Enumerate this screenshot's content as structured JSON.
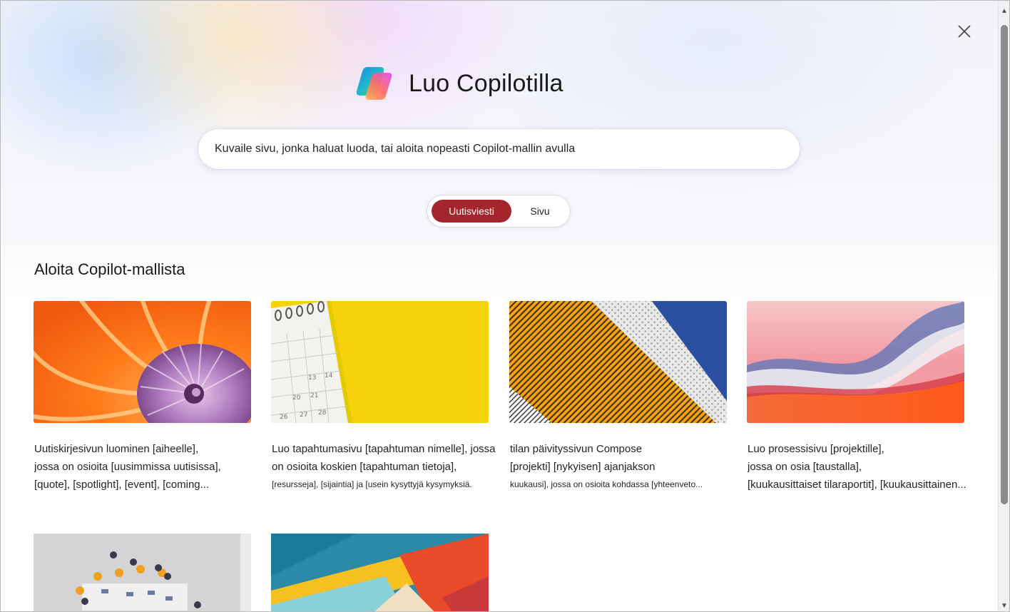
{
  "dialog": {
    "title": "Luo Copilotilla",
    "prompt_placeholder": "Kuvaile sivu, jonka haluat luoda, tai aloita nopeasti Copilot-mallin avulla",
    "close_icon": "close-icon",
    "logo_icon": "copilot-logo-icon"
  },
  "toggle": {
    "options": [
      {
        "label": "Uutisviesti",
        "selected": true
      },
      {
        "label": "Sivu",
        "selected": false
      }
    ],
    "accent": "#a4262c"
  },
  "templates": {
    "heading": "Aloita Copilot-mallista",
    "cards": [
      {
        "image": "orange-nautilus-shell",
        "lines": [
          "Uutiskirjesivun luominen [aiheelle],",
          "jossa on osioita [uusimmissa uutisissa],",
          "[quote], [spotlight], [event], [coming..."
        ]
      },
      {
        "image": "yellow-calendar",
        "lines": [
          "Luo tapahtumasivu [tapahtuman nimelle], jossa",
          "on osioita koskien [tapahtuman tietoja],",
          "[resursseja], [sijaintia] ja [usein kysyttyjä kysymyksiä."
        ]
      },
      {
        "image": "yellow-building-facade",
        "lines": [
          "tilan päivityssivun Compose",
          "[projekti] [nykyisen] ajanjakson",
          "kuukausi], jossa on osioita kohdassa [yhteenveto..."
        ]
      },
      {
        "image": "pink-red-abstract-wave",
        "lines": [
          "Luo prosessisivu [projektille],",
          "jossa on osia [taustalla],",
          "[kuukausittaiset tilaraportit], [kuukausittainen..."
        ]
      },
      {
        "image": "office-meeting-aerial",
        "lines": []
      },
      {
        "image": "colorful-geometric-abstract",
        "lines": []
      }
    ]
  }
}
